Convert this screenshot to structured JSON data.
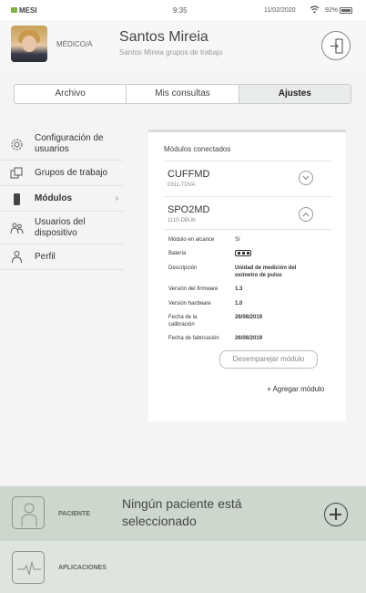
{
  "status_bar": {
    "carrier": "MESI",
    "time": "9:35",
    "date": "11/02/2020",
    "battery": "92%"
  },
  "header": {
    "role": "MÉDICO/A",
    "user_name": "Santos Mireia",
    "user_subtitle": "Santos Mireia grupos de trabajo"
  },
  "tabs": [
    {
      "label": "Archivo",
      "active": false
    },
    {
      "label": "Mis consultas",
      "active": false
    },
    {
      "label": "Ajustes",
      "active": true
    }
  ],
  "sidebar": {
    "items": [
      {
        "label": "Configuración de usuarios",
        "icon": "gear-icon"
      },
      {
        "label": "Grupos de trabajo",
        "icon": "groups-icon"
      },
      {
        "label": "Módulos",
        "icon": "module-icon",
        "active": true
      },
      {
        "label": "Usuarios del dispositivo",
        "icon": "users-icon"
      },
      {
        "label": "Perfil",
        "icon": "person-icon"
      }
    ]
  },
  "modules": {
    "title": "Módulos conectados",
    "list": [
      {
        "name": "CUFFMD",
        "code": "0311-TDVA",
        "expanded": false
      },
      {
        "name": "SPO2MD",
        "code": "1110-DBUK",
        "expanded": true
      }
    ],
    "details": [
      {
        "label": "Módulo en alcance",
        "value": "Sí"
      },
      {
        "label": "Batería",
        "value": ""
      },
      {
        "label": "Descripción",
        "value": "Unidad de medición del oxímetro de pulso"
      },
      {
        "label": "Versión del firmware",
        "value": "1.3"
      },
      {
        "label": "Versión hardware",
        "value": "1.0"
      },
      {
        "label": "Fecha de la calibración",
        "value": "26/08/2019"
      },
      {
        "label": "Fecha de fabricación",
        "value": "26/08/2019"
      }
    ],
    "battery_level_bars": 3,
    "battery_level_max": 3,
    "unpair_label": "Desemparejar módulo",
    "add_label": "+ Agregar módulo"
  },
  "bottom": {
    "patient_label": "PACIENTE",
    "no_patient_text": "Ningún paciente está seleccionado",
    "apps_label": "APLICACIONES"
  }
}
